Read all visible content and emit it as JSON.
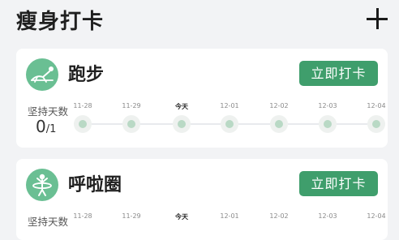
{
  "header": {
    "title": "瘦身打卡",
    "add_icon": "plus-icon"
  },
  "habits": [
    {
      "name": "跑步",
      "icon": "running-icon",
      "checkin_label": "立即打卡",
      "streak_label": "坚持天数",
      "streak_current": "0",
      "streak_total": "/1",
      "dates": [
        "11-28",
        "11-29",
        "今天",
        "12-01",
        "12-02",
        "12-03",
        "12-04"
      ]
    },
    {
      "name": "呼啦圈",
      "icon": "hula-hoop-icon",
      "checkin_label": "立即打卡",
      "streak_label": "坚持天数",
      "dates": [
        "11-28",
        "11-29",
        "今天",
        "12-01",
        "12-02",
        "12-03",
        "12-04"
      ]
    }
  ],
  "colors": {
    "accent": "#3f9e6c",
    "icon_bg": "#6abf93",
    "dot": "#b9d9c5",
    "background": "#f2f3f5"
  }
}
